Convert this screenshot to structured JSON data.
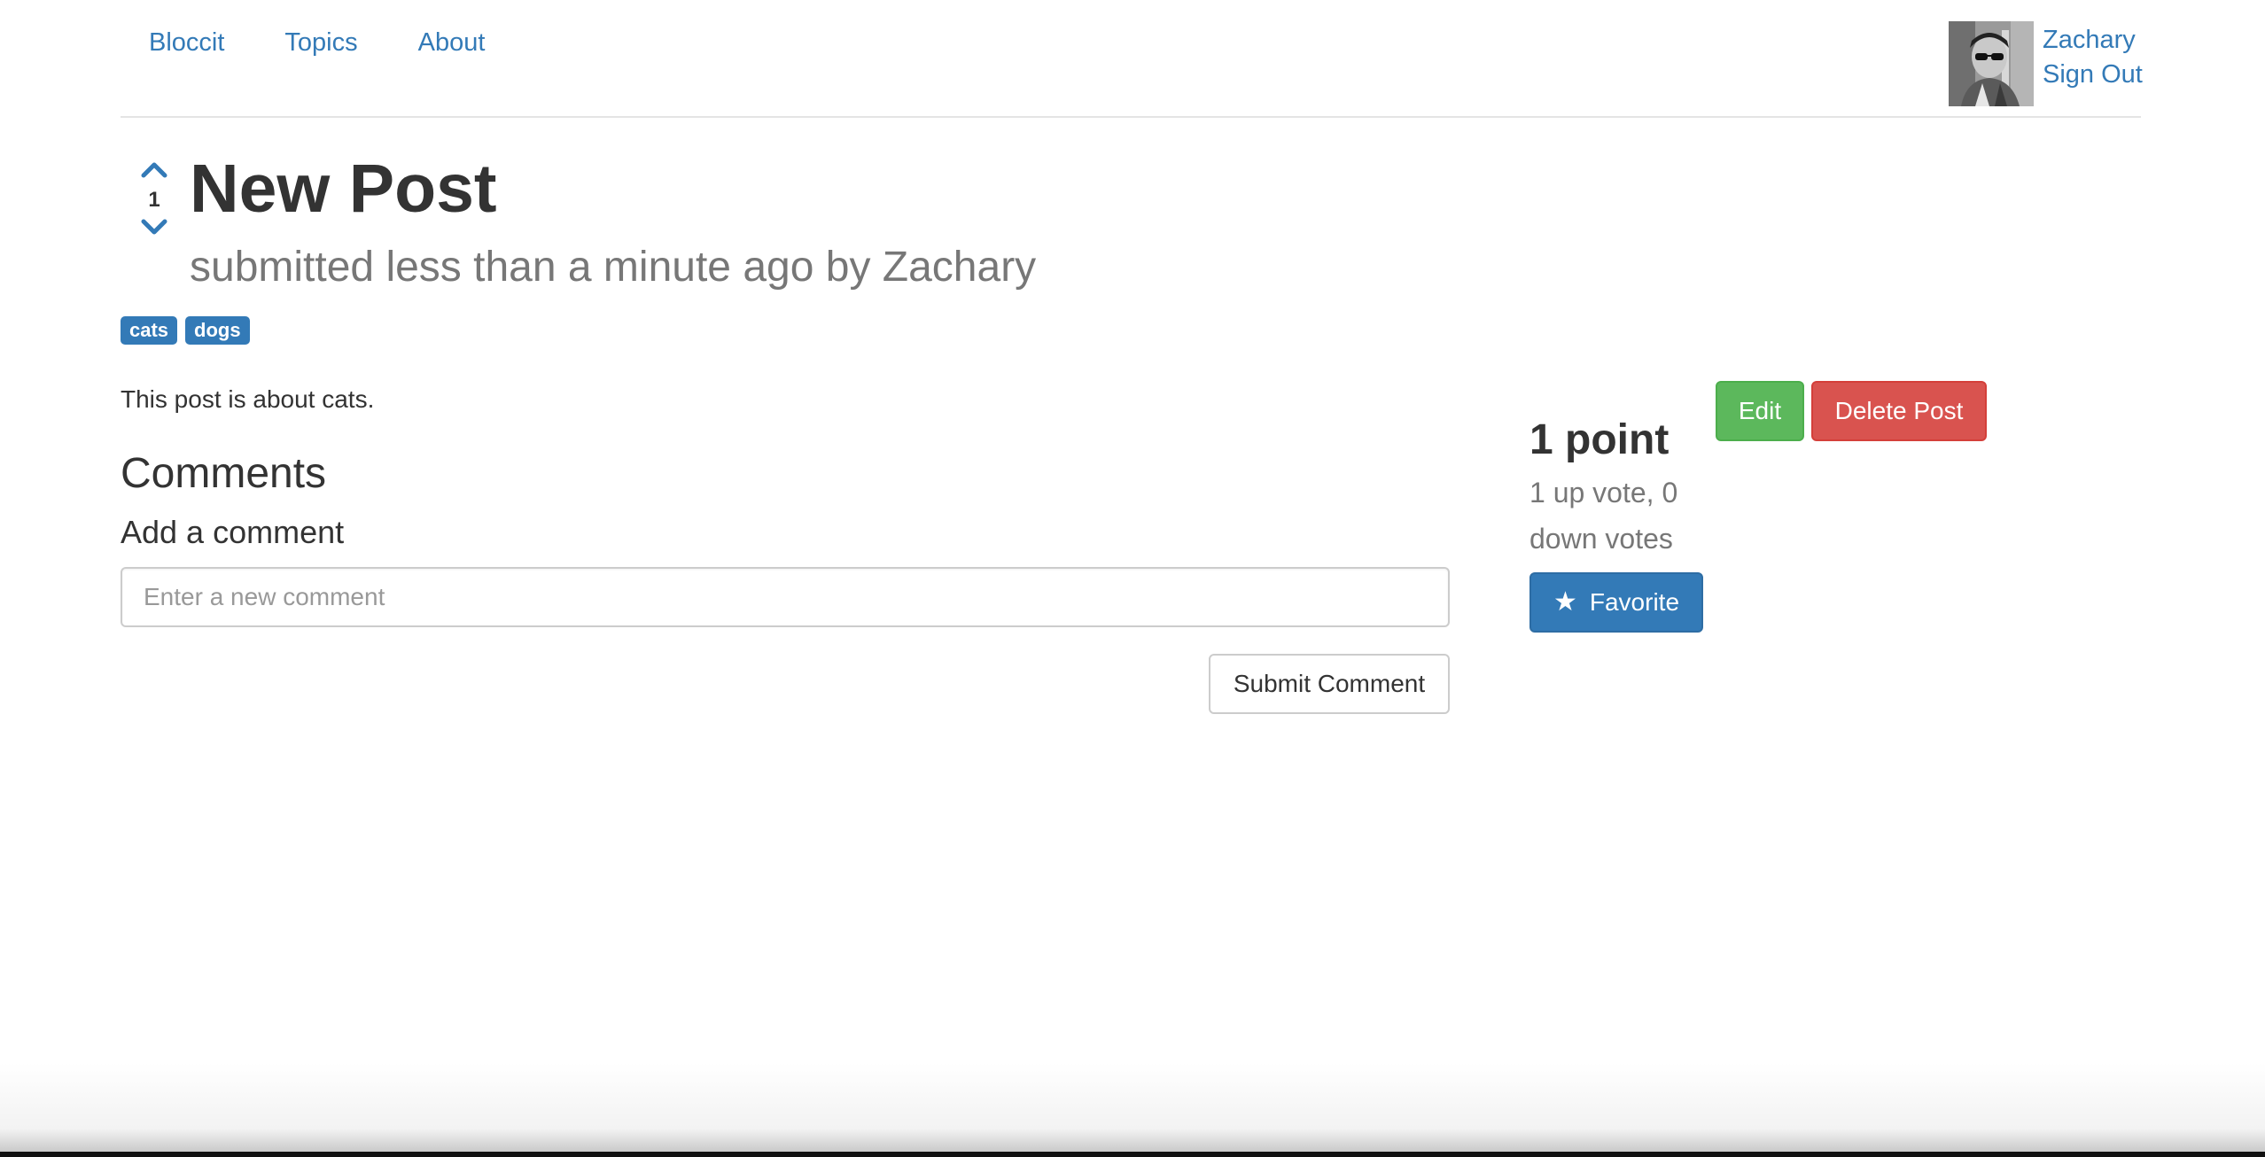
{
  "nav": {
    "brand": "Bloccit",
    "topics": "Topics",
    "about": "About"
  },
  "user": {
    "name": "Zachary",
    "sign_out": "Sign Out"
  },
  "post": {
    "vote_count": "1",
    "title": "New Post",
    "subtitle": "submitted less than a minute ago by Zachary",
    "tags": [
      "cats",
      "dogs"
    ],
    "body": "This post is about cats."
  },
  "comments": {
    "heading": "Comments",
    "add_heading": "Add a comment",
    "input_placeholder": "Enter a new comment",
    "input_value": "",
    "submit_label": "Submit Comment"
  },
  "sidebar": {
    "edit_label": "Edit",
    "delete_label": "Delete Post",
    "points": "1 point",
    "votes_detail": "1 up vote, 0 down votes",
    "favorite_label": "Favorite",
    "favorite_icon": "star-icon"
  },
  "colors": {
    "link": "#337ab7",
    "primary": "#337ab7",
    "success": "#5cb85c",
    "danger": "#d9534f",
    "muted": "#777777"
  }
}
